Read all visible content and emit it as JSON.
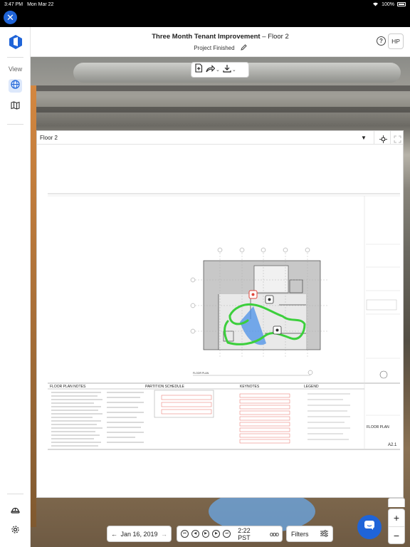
{
  "status_bar": {
    "time": "3:47 PM",
    "date": "Mon Mar 22",
    "battery": "100%"
  },
  "header": {
    "project_name": "Three Month Tenant Improvement",
    "separator": "–",
    "floor": "Floor 2",
    "status": "Project Finished",
    "avatar_initials": "HP"
  },
  "rail": {
    "view_label": "View"
  },
  "panel": {
    "floor_label": "Floor 2"
  },
  "sheet": {
    "plan_label": "FLOOR PLAN",
    "notes_heading": "FLOOR PLAN NOTES",
    "schedule_heading": "PARTITION SCHEDULE",
    "keynotes_heading": "KEYNOTES",
    "legend_heading": "LEGEND",
    "title_block_name": "FLOOR PLAN",
    "sheet_number": "A2.1"
  },
  "bottom": {
    "date": "Jan 16, 2019",
    "time": "2:22 PST",
    "filters_label": "Filters"
  },
  "colors": {
    "accent": "#1f64d8",
    "path": "#3ccf3c",
    "marker": "#e0453a"
  }
}
